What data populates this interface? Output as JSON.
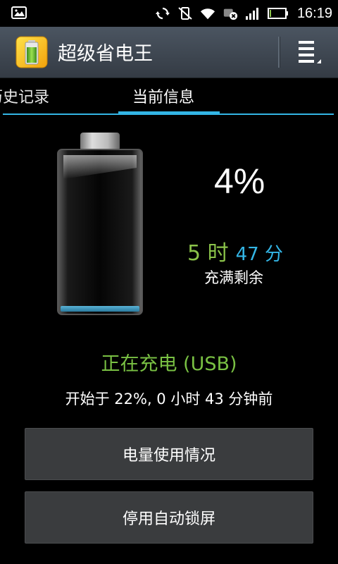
{
  "status_bar": {
    "time": "16:19",
    "icons": [
      "image-icon",
      "sync-icon",
      "vibrate-silent-icon",
      "wifi-icon",
      "usb-storage-icon",
      "signal-icon",
      "battery-icon"
    ],
    "battery_level": 0.04
  },
  "app": {
    "title": "超级省电王",
    "icon": "battery-app-icon",
    "menu_icon": "menu-icon"
  },
  "tabs": [
    {
      "label": "历史记录",
      "visible_text": "历史记录",
      "active": false
    },
    {
      "label": "当前信息",
      "active": true
    }
  ],
  "battery": {
    "percent": "4%",
    "level": 0.04,
    "hours": "5 时",
    "minutes": "47 分",
    "remain_label": "充满剩余",
    "status": "正在充电 (USB)",
    "started": "开始于 22%, 0 小时 43 分钟前"
  },
  "buttons": {
    "usage": "电量使用情况",
    "disable_lock": "停用自动锁屏"
  },
  "colors": {
    "accent_blue": "#33b5e5",
    "green": "#79c043",
    "action_bar": "#3f4852"
  }
}
